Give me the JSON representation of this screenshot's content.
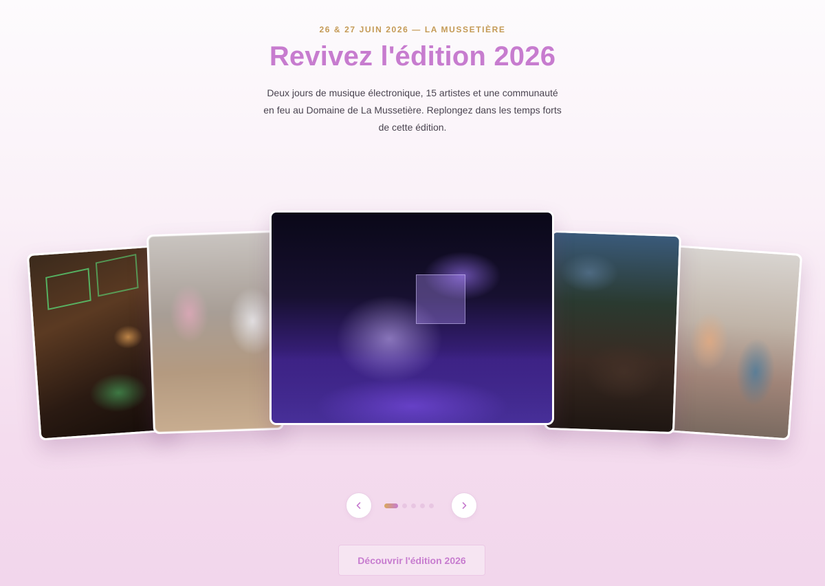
{
  "hero": {
    "eyebrow": "26 & 27 JUIN 2026 — LA MUSSETIÈRE",
    "title": "Revivez l'édition 2026",
    "description": "Deux jours de musique électronique, 15 artistes et une communauté en feu au Domaine de La Mussetière. Replongez dans les temps forts de cette édition."
  },
  "carousel": {
    "active_index": 0,
    "slide_count": 5,
    "prev_icon": "chevron-left-icon",
    "next_icon": "chevron-right-icon"
  },
  "cta": {
    "label": "Découvrir l'édition 2026"
  },
  "colors": {
    "accent": "#c77ccf",
    "gold": "#c49a55",
    "text": "#4a4450"
  }
}
